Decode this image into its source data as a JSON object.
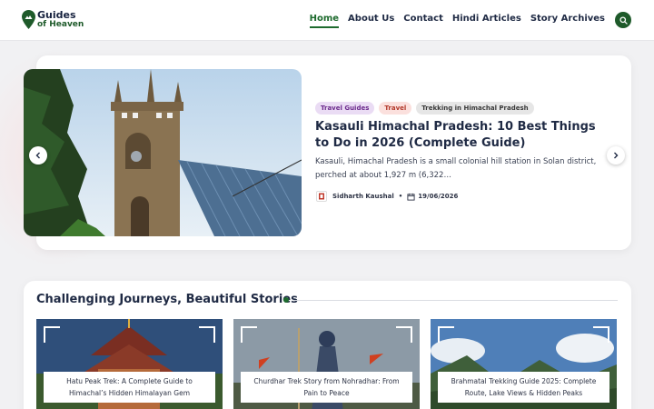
{
  "header": {
    "logo_line1": "Guides",
    "logo_line2": "of Heaven",
    "nav": [
      {
        "label": "Home",
        "active": true
      },
      {
        "label": "About Us",
        "active": false
      },
      {
        "label": "Contact",
        "active": false
      },
      {
        "label": "Hindi Articles",
        "active": false
      },
      {
        "label": "Story Archives",
        "active": false
      }
    ],
    "search_icon": "search-icon"
  },
  "hero": {
    "tags": [
      "Travel Guides",
      "Travel",
      "Trekking in Himachal Pradesh"
    ],
    "title": "Kasauli Himachal Pradesh: 10 Best Things to Do in 2026 (Complete Guide)",
    "excerpt": "Kasauli, Himachal Pradesh is a small colonial hill station in Solan district, perched at about 1,927 m (6,322…",
    "author": "Sidharth Kaushal",
    "date": "19/06/2026",
    "prev_icon": "chevron-left-icon",
    "next_icon": "chevron-right-icon"
  },
  "section": {
    "title": "Challenging Journeys, Beautiful Stories",
    "cards": [
      {
        "title": "Hatu Peak Trek: A Complete Guide to Himachal’s Hidden Himalayan Gem"
      },
      {
        "title": "Churdhar Trek Story from Nohradhar: From Pain to Peace"
      },
      {
        "title": "Brahmatal Trekking Guide 2025: Complete Route, Lake Views & Hidden Peaks"
      }
    ]
  },
  "colors": {
    "brand_green": "#1e6b2e",
    "navy_text": "#1f2a44",
    "background": "#f1f1f3"
  }
}
